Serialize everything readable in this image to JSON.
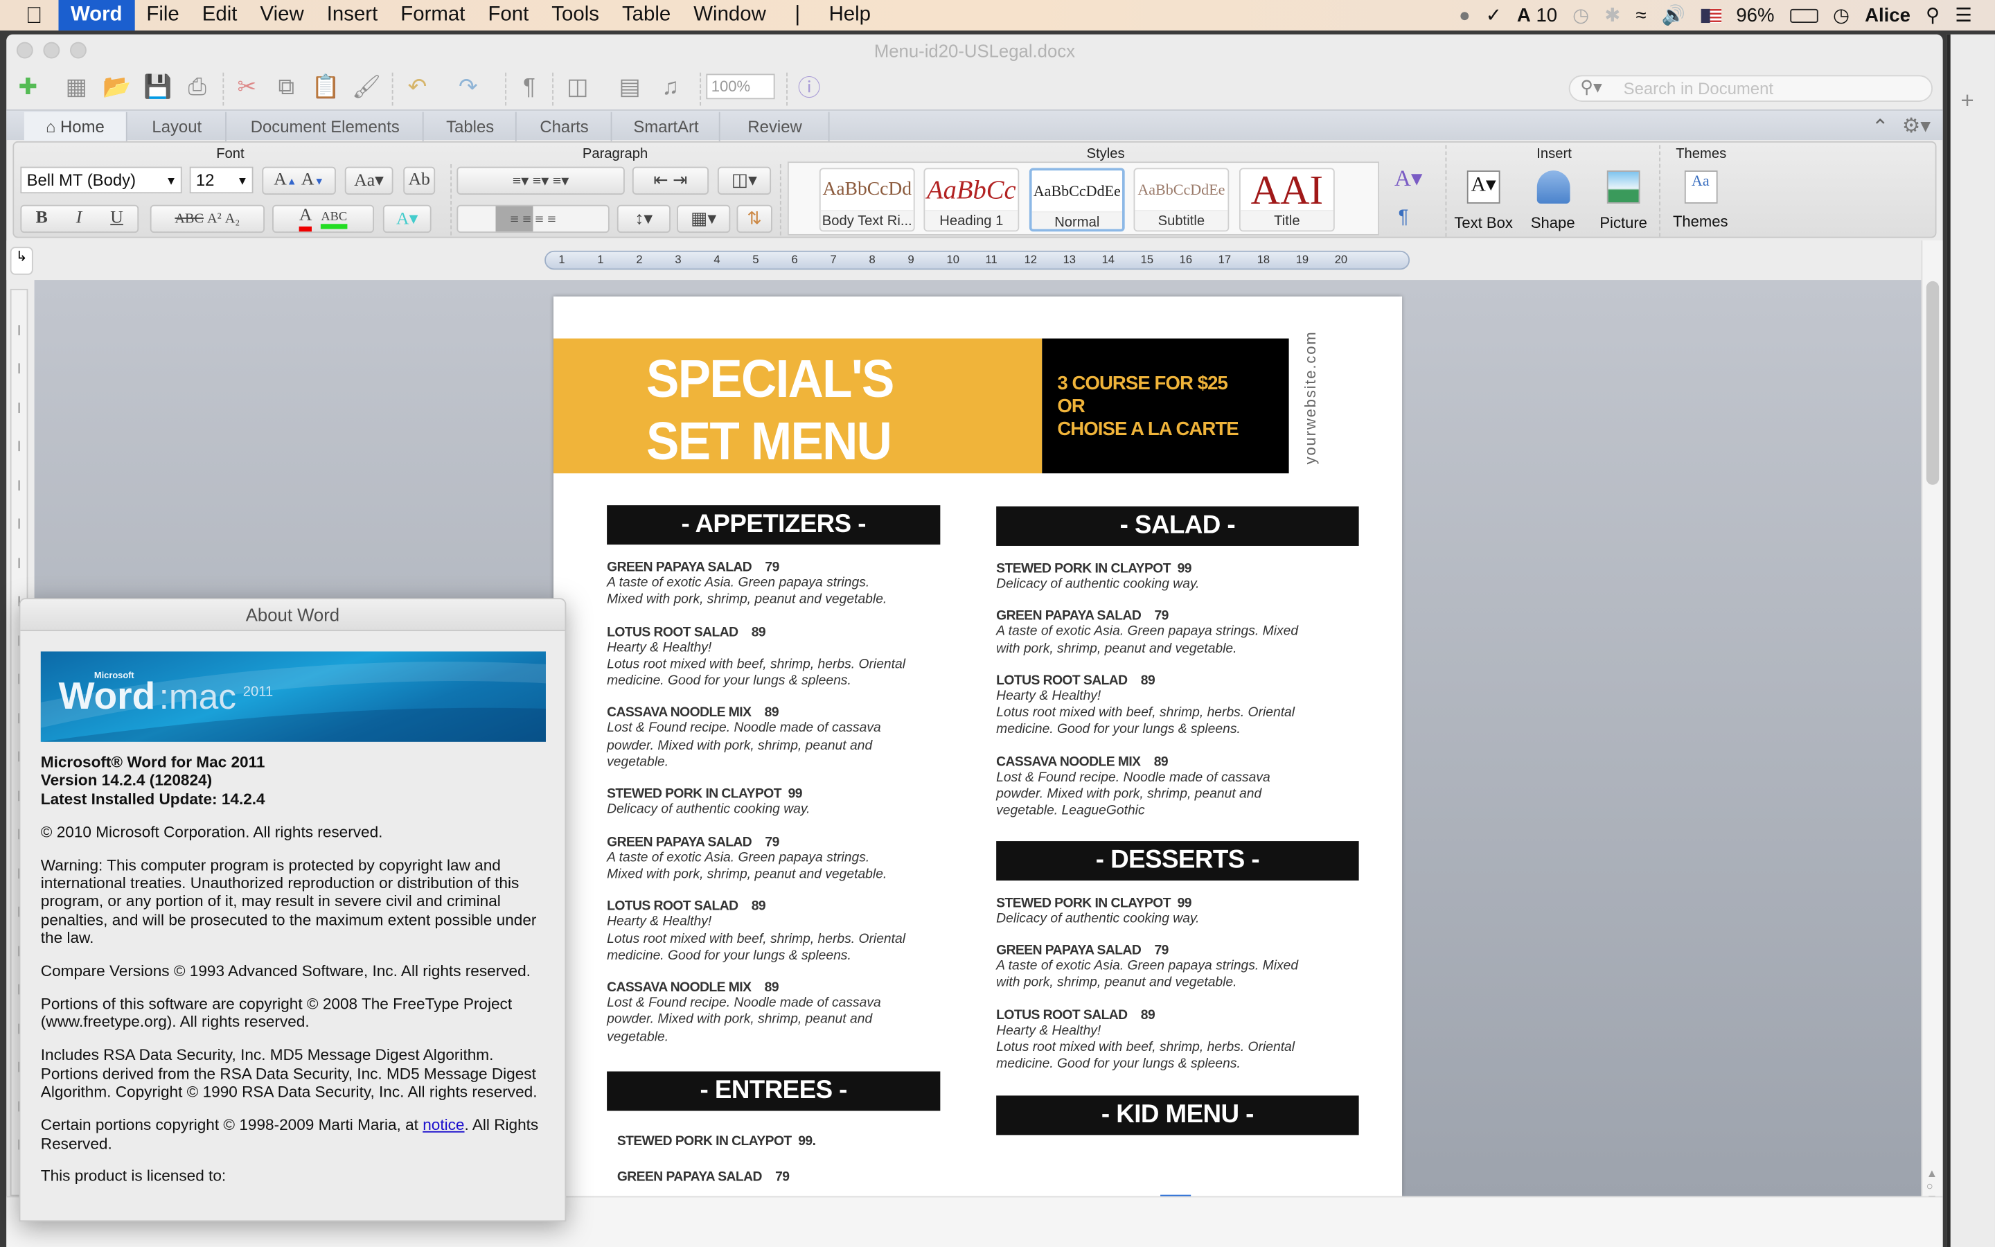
{
  "menubar": {
    "app": "Word",
    "items": [
      "File",
      "Edit",
      "View",
      "Insert",
      "Format",
      "Font",
      "Tools",
      "Table",
      "Window",
      "Help"
    ],
    "status": {
      "adobe_count": "10",
      "battery": "96%",
      "user": "Alice"
    }
  },
  "window": {
    "title": "Menu-id20-USLegal.docx",
    "zoom": "100%",
    "search_placeholder": "Search in Document"
  },
  "tabs": [
    "Home",
    "Layout",
    "Document Elements",
    "Tables",
    "Charts",
    "SmartArt",
    "Review"
  ],
  "active_tab": "Home",
  "ribbon": {
    "groups": {
      "font": "Font",
      "paragraph": "Paragraph",
      "styles": "Styles",
      "insert": "Insert",
      "themes": "Themes"
    },
    "font_name": "Bell MT (Body)",
    "font_size": "12",
    "styles": [
      {
        "preview": "AaBbCcDd",
        "name": "Body Text Ri...",
        "color": "#8b5a3c"
      },
      {
        "preview": "AaBbCc",
        "name": "Heading 1",
        "color": "#b22222"
      },
      {
        "preview": "AaBbCcDdEe",
        "name": "Normal",
        "color": "#222222"
      },
      {
        "preview": "AaBbCcDdEe",
        "name": "Subtitle",
        "color": "#9b7b6b"
      },
      {
        "preview": "AAI",
        "name": "Title",
        "color": "#a01818"
      }
    ],
    "insert": [
      "Text Box",
      "Shape",
      "Picture"
    ],
    "themes": "Themes"
  },
  "ruler": {
    "ticks": [
      "1",
      "1",
      "2",
      "3",
      "4",
      "5",
      "6",
      "7",
      "8",
      "9",
      "10",
      "11",
      "12",
      "13",
      "14",
      "15",
      "16",
      "17",
      "18",
      "19",
      "20"
    ]
  },
  "document": {
    "header": {
      "title_line1": "SPECIAL'S",
      "title_line2": "SET MENU",
      "offer": [
        "3 COURSE FOR $25",
        "OR",
        "CHOISE A LA CARTE"
      ],
      "website": "yourwebsite.com",
      "band_color": "#f0b43a"
    },
    "left_column": [
      {
        "heading": "- APPETIZERS -",
        "items": [
          {
            "title": "GREEN PAPAYA SALAD    79",
            "desc": "A taste of exotic Asia. Green papaya strings.\nMixed with pork, shrimp, peanut and vegetable."
          },
          {
            "title": "LOTUS ROOT SALAD    89",
            "desc": "Hearty & Healthy!\nLotus root mixed with beef, shrimp, herbs. Oriental\nmedicine. Good for your lungs & spleens."
          },
          {
            "title": "CASSAVA NOODLE MIX    89",
            "desc": "Lost & Found recipe. Noodle made of cassava\npowder. Mixed with pork, shrimp, peanut and\nvegetable."
          },
          {
            "title": "STEWED PORK IN CLAYPOT  99",
            "desc": "Delicacy of authentic cooking way."
          },
          {
            "title": "GREEN PAPAYA SALAD    79",
            "desc": "A taste of exotic Asia. Green papaya strings.\nMixed with pork, shrimp, peanut and vegetable."
          },
          {
            "title": "LOTUS ROOT SALAD    89",
            "desc": "Hearty & Healthy!\nLotus root mixed with beef, shrimp, herbs. Oriental\nmedicine. Good for your lungs & spleens."
          },
          {
            "title": "CASSAVA NOODLE MIX    89",
            "desc": "Lost & Found recipe. Noodle made of cassava\npowder. Mixed with pork, shrimp, peanut and\nvegetable."
          }
        ]
      },
      {
        "heading": "- ENTREES -",
        "items": [
          {
            "title": "STEWED PORK IN CLAYPOT  99.",
            "desc": ""
          },
          {
            "title": "GREEN PAPAYA SALAD    79",
            "desc": ""
          }
        ]
      }
    ],
    "right_column": [
      {
        "heading": "- SALAD -",
        "items": [
          {
            "title": "STEWED PORK IN CLAYPOT  99",
            "desc": "Delicacy of authentic cooking way."
          },
          {
            "title": "GREEN PAPAYA SALAD    79",
            "desc": "A taste of exotic Asia. Green papaya strings. Mixed\nwith pork, shrimp, peanut and vegetable."
          },
          {
            "title": "LOTUS ROOT SALAD    89",
            "desc": "Hearty & Healthy!\nLotus root mixed with beef, shrimp, herbs. Oriental\nmedicine. Good for your lungs & spleens."
          },
          {
            "title": "CASSAVA NOODLE MIX    89",
            "desc": "Lost & Found recipe. Noodle made of cassava\npowder. Mixed with pork, shrimp, peanut and\nvegetable. LeagueGothic"
          }
        ]
      },
      {
        "heading": "- DESSERTS -",
        "items": [
          {
            "title": "STEWED PORK IN CLAYPOT  99",
            "desc": "Delicacy of authentic cooking way."
          },
          {
            "title": "GREEN PAPAYA SALAD    79",
            "desc": "A taste of exotic Asia. Green papaya strings. Mixed\nwith pork, shrimp, peanut and vegetable."
          },
          {
            "title": "LOTUS ROOT SALAD    89",
            "desc": "Hearty & Healthy!\nLotus root mixed with beef, shrimp, herbs. Oriental\nmedicine. Good for your lungs & spleens."
          }
        ]
      },
      {
        "heading": "- KID MENU -",
        "items": []
      }
    ]
  },
  "about": {
    "title": "About Word",
    "logo_text": "Microsoft Word:mac 2011",
    "product": "Microsoft® Word for Mac 2011",
    "version": "Version 14.2.4 (120824)",
    "update": "Latest Installed Update: 14.2.4",
    "copyright": "© 2010 Microsoft Corporation. All rights reserved.",
    "warning": "Warning: This computer program is protected by copyright law and international treaties.  Unauthorized reproduction or distribution of this program, or any portion of it, may result in severe civil and criminal penalties, and will be prosecuted to the maximum extent possible under the law.",
    "compare": "Compare Versions © 1993 Advanced Software, Inc.  All rights reserved.",
    "freetype": "Portions of this software are copyright © 2008 The FreeType Project (www.freetype.org).  All rights reserved.",
    "rsa": "Includes RSA Data Security, Inc. MD5 Message Digest Algorithm.  Portions derived from the RSA Data Security, Inc. MD5 Message Digest Algorithm.  Copyright © 1990 RSA Data Security, Inc. All rights reserved.",
    "marti_prefix": "Certain portions copyright © 1998-2009  Marti Maria, at ",
    "marti_link": "notice",
    "marti_suffix": ".  All Rights Reserved.",
    "licensed": "This product is licensed to:"
  }
}
